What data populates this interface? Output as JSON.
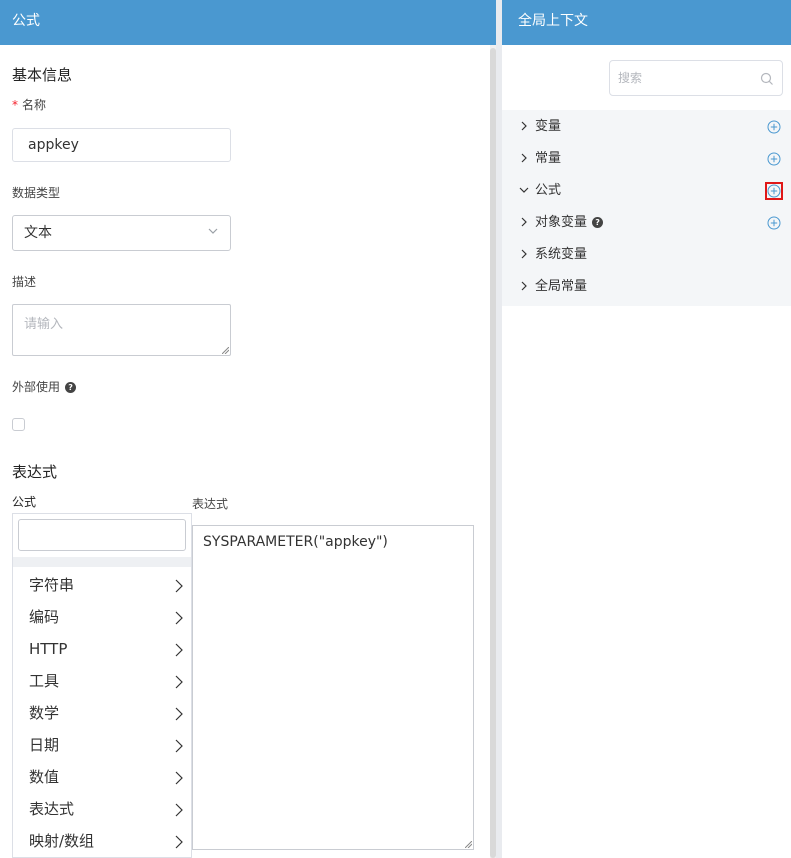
{
  "left_panel": {
    "title": "公式",
    "basic_info_title": "基本信息",
    "name_required_mark": "*",
    "name_label": "名称",
    "name_value": "appkey",
    "datatype_label": "数据类型",
    "datatype_value": "文本",
    "description_label": "描述",
    "description_placeholder": "请输入",
    "external_use_label": "外部使用",
    "expression_title": "表达式",
    "formula_label": "公式",
    "expression_label": "表达式",
    "formula_categories": [
      "字符串",
      "编码",
      "HTTP",
      "工具",
      "数学",
      "日期",
      "数值",
      "表达式",
      "映射/数组"
    ],
    "expression_value": "SYSPARAMETER(\"appkey\")"
  },
  "right_panel": {
    "title": "全局上下文",
    "search_placeholder": "搜索",
    "tree_items": [
      {
        "label": "变量",
        "expanded": false,
        "has_add": true
      },
      {
        "label": "常量",
        "expanded": false,
        "has_add": true
      },
      {
        "label": "公式",
        "expanded": true,
        "has_add": true,
        "highlighted": true
      },
      {
        "label": "对象变量",
        "expanded": false,
        "has_add": true,
        "has_help": true
      },
      {
        "label": "系统变量",
        "expanded": false,
        "has_add": false
      },
      {
        "label": "全局常量",
        "expanded": false,
        "has_add": false
      }
    ]
  },
  "colors": {
    "header_bg": "#4a98d0",
    "accent": "#4a98d0",
    "required": "#f5222d",
    "highlight_box": "#e01818"
  },
  "icons": {
    "select_arrow": "chevron-down-icon",
    "category_arrow": "chevron-right-icon",
    "search": "search-icon",
    "add": "plus-circle-icon",
    "help": "question-circle-icon"
  }
}
